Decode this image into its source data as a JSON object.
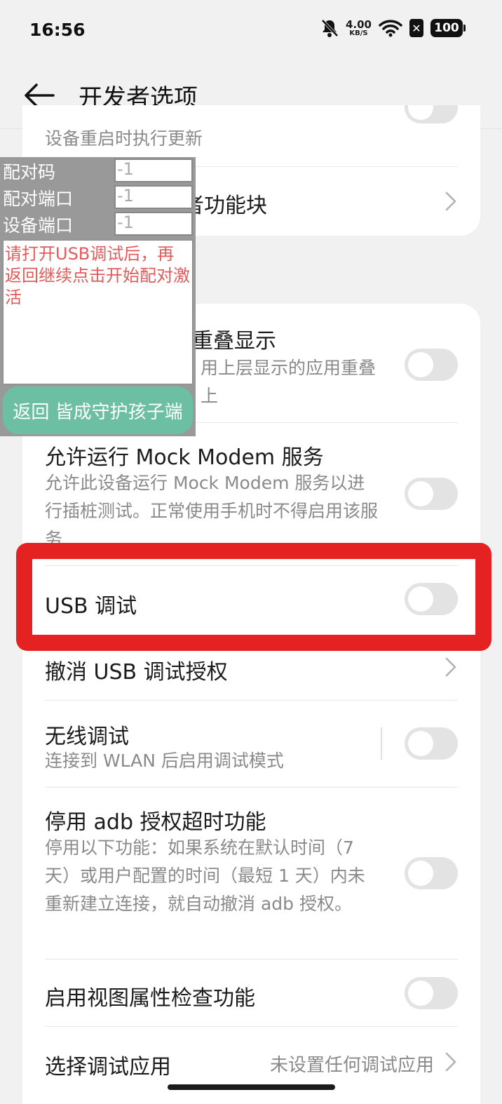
{
  "status_bar": {
    "time": "16:56",
    "net_speed": "4.00",
    "net_unit": "KB/S",
    "sim": "✕",
    "battery": "100",
    "icons": [
      "bell-off-icon",
      "wifi-icon",
      "sim-icon",
      "battery-icon"
    ]
  },
  "header": {
    "title": "开发者选项",
    "back_icon": "arrow-left-icon"
  },
  "card1": {
    "row1_desc": "设备重启时执行更新",
    "row2_title_partial": "者功能块"
  },
  "overlay": {
    "pair_code_label": "配对码",
    "pair_code_value": "-1",
    "pair_port_label": "配对端口",
    "pair_port_value": "-1",
    "device_port_label": "设备端口",
    "device_port_value": "-1",
    "message": "请打开USB调试后，再返回继续点击开始配对激活",
    "button": "返回 皆成守护孩子端"
  },
  "card2": {
    "overlay_title_partial": "重叠显示",
    "overlay_desc_partial_1": "用上层显示的应用重叠",
    "overlay_desc_partial_2": "上",
    "mock_modem_title": "允许运行 Mock Modem 服务",
    "mock_modem_desc": "允许此设备运行 Mock Modem 服务以进行插桩测试。正常使用手机时不得启用该服务",
    "usb_debug_title": "USB 调试",
    "revoke_usb_title": "撤消 USB 调试授权",
    "wireless_debug_title": "无线调试",
    "wireless_debug_desc": "连接到 WLAN 后启用调试模式",
    "adb_timeout_title": "停用 adb 授权超时功能",
    "adb_timeout_desc": "停用以下功能：如果系统在默认时间（7 天）或用户配置的时间（最短 1 天）内未重新建立连接，就自动撤消 adb 授权。",
    "view_attr_title": "启用视图属性检查功能",
    "select_debug_app_title": "选择调试应用",
    "select_debug_app_value": "未设置任何调试应用"
  },
  "toggles": {
    "update_on_reboot": false,
    "overlay_display": false,
    "mock_modem": false,
    "usb_debug": false,
    "wireless_debug": false,
    "adb_timeout": false,
    "view_attr": false
  },
  "colors": {
    "highlight": "#e52222",
    "overlay_bg": "#999999",
    "overlay_button": "#6cbfa3",
    "overlay_message": "#e25a5a"
  }
}
